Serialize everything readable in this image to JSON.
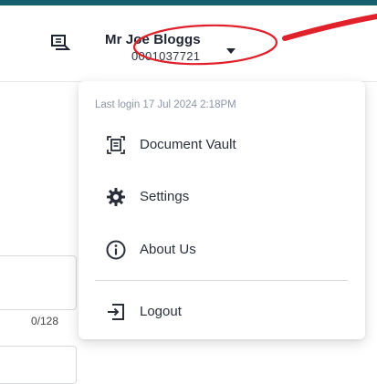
{
  "header": {
    "user_name": "Mr Joe Bloggs",
    "user_id": "0001037721"
  },
  "account_menu": {
    "last_login": "Last login 17 Jul 2024 2:18PM",
    "items": [
      {
        "label": "Document Vault",
        "icon": "document-vault-icon"
      },
      {
        "label": "Settings",
        "icon": "gear-icon"
      },
      {
        "label": "About Us",
        "icon": "info-icon"
      },
      {
        "label": "Logout",
        "icon": "logout-icon"
      }
    ]
  },
  "form": {
    "char_count": "0/128"
  },
  "colors": {
    "accent_bar": "#155f6e",
    "annotation": "#e0202a",
    "muted_text": "#8c95a6"
  }
}
